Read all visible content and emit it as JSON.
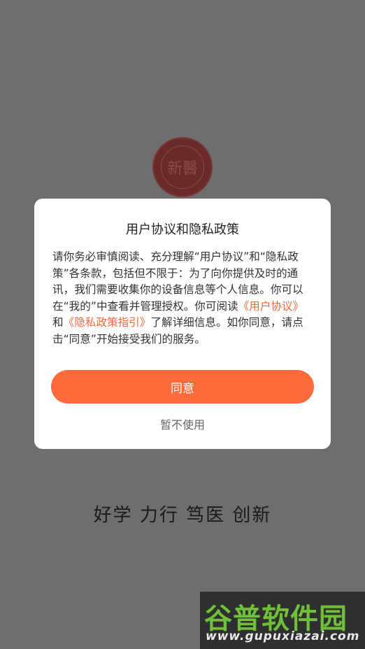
{
  "background": {
    "seal_glyph": "新醫",
    "motto": "好学 力行 笃医 创新"
  },
  "dialog": {
    "title": "用户协议和隐私政策",
    "body": {
      "part1": "请你务必审慎阅读、充分理解“用户协议”和“隐私政策”各条款，包括但不限于：为了向你提供及时的通讯，我们需要收集你的设备信息等个人信息。你可以在“我的”中查看并管理授权。你可阅读",
      "link_user_agreement": "《用户协议》",
      "part2": "和",
      "link_privacy_guide": "《隐私政策指引》",
      "part3": "了解详细信息。如你同意，请点击“同意”开始接受我们的服务。"
    },
    "agree_label": "同意",
    "decline_label": "暂不使用"
  },
  "watermark": {
    "title": "谷普软件园",
    "url": "www.gupuxiazai.com"
  },
  "colors": {
    "accent": "#fe6b3a",
    "link": "#f0693a",
    "overlay": "#6e6e6e"
  }
}
